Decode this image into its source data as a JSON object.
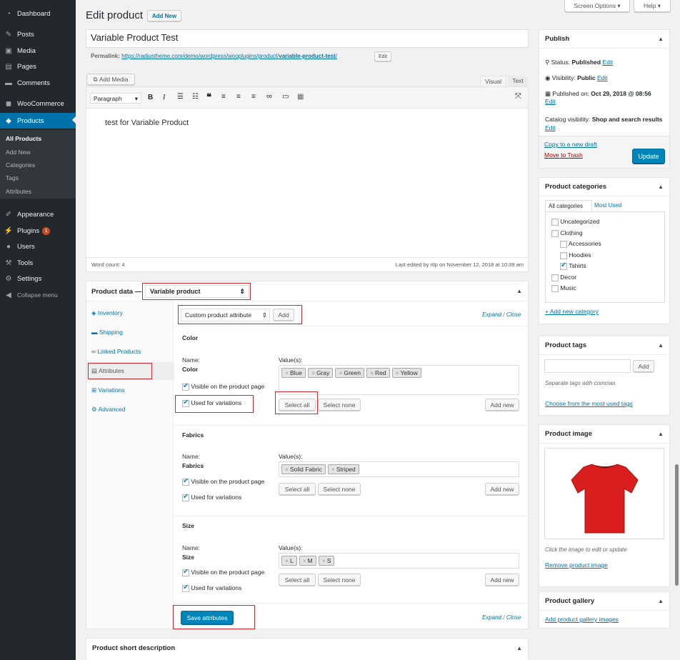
{
  "menu": {
    "dashboard": "Dashboard",
    "posts": "Posts",
    "media": "Media",
    "pages": "Pages",
    "comments": "Comments",
    "woocommerce": "WooCommerce",
    "products": "Products",
    "appearance": "Appearance",
    "plugins": "Plugins",
    "plugins_badge": "1",
    "users": "Users",
    "tools": "Tools",
    "settings": "Settings",
    "collapse": "Collapse menu"
  },
  "submenu": {
    "all_products": "All Products",
    "add_new": "Add New",
    "categories": "Categories",
    "tags": "Tags",
    "attributes": "Attributes"
  },
  "top": {
    "screen_options": "Screen Options",
    "help": "Help"
  },
  "page": {
    "title": "Edit product",
    "add_new": "Add New",
    "product_title": "Variable Product Test",
    "permalink_label": "Permalink:",
    "permalink_base": "https://radiustheme.com/demo/wordpress/wooplugins/product/",
    "permalink_slug": "variable-product-test",
    "permalink_end": "/",
    "edit": "Edit"
  },
  "editor": {
    "add_media": "Add Media",
    "tab_visual": "Visual",
    "tab_text": "Text",
    "paragraph": "Paragraph",
    "content": "test for Variable Product",
    "word_count": "Word count: 4",
    "last_edited": "Last edited by rtlp on November 12, 2018 at 10:39 am"
  },
  "product_data": {
    "label": "Product data —",
    "type": "Variable product",
    "tabs": [
      "Inventory",
      "Shipping",
      "Linked Products",
      "Attributes",
      "Variations",
      "Advanced"
    ],
    "custom_attr": "Custom product attribute",
    "add": "Add",
    "expand": "Expand",
    "close": "Close",
    "sep": " / ",
    "name_label": "Name:",
    "values_label": "Value(s):",
    "visible": "Visible on the product page",
    "used": "Used for variations",
    "select_all": "Select all",
    "select_none": "Select none",
    "add_new": "Add new",
    "save": "Save attributes",
    "attributes": [
      {
        "title": "Color",
        "name": "Color",
        "values": [
          "Blue",
          "Gray",
          "Green",
          "Red",
          "Yellow"
        ]
      },
      {
        "title": "Fabrics",
        "name": "Fabrics",
        "values": [
          "Solid Fabric",
          "Striped"
        ]
      },
      {
        "title": "Size",
        "name": "Size",
        "values": [
          "L",
          "M",
          "S"
        ]
      }
    ]
  },
  "short_desc": {
    "title": "Product short description"
  },
  "publish": {
    "title": "Publish",
    "status_label": "Status:",
    "status": "Published",
    "edit": "Edit",
    "visibility_label": "Visibility:",
    "visibility": "Public",
    "published_label": "Published on:",
    "published": "Oct 29, 2018 @ 08:56",
    "catalog_label": "Catalog visibility:",
    "catalog": "Shop and search results",
    "copy": "Copy to a new draft",
    "trash": "Move to Trash",
    "update": "Update"
  },
  "categories": {
    "title": "Product categories",
    "tab_all": "All categories",
    "tab_most": "Most Used",
    "items": [
      {
        "label": "Uncategorized",
        "checked": false,
        "level": 0
      },
      {
        "label": "Clothing",
        "checked": false,
        "level": 0
      },
      {
        "label": "Accessories",
        "checked": false,
        "level": 1
      },
      {
        "label": "Hoodies",
        "checked": false,
        "level": 1
      },
      {
        "label": "Tshirts",
        "checked": true,
        "level": 1
      },
      {
        "label": "Decor",
        "checked": false,
        "level": 0
      },
      {
        "label": "Music",
        "checked": false,
        "level": 0
      }
    ],
    "add_new": "+ Add new category"
  },
  "tags": {
    "title": "Product tags",
    "add": "Add",
    "hint": "Separate tags with commas",
    "choose": "Choose from the most used tags"
  },
  "image": {
    "title": "Product image",
    "hint": "Click the image to edit or update",
    "remove": "Remove product image"
  },
  "gallery": {
    "title": "Product gallery",
    "add": "Add product gallery images"
  }
}
